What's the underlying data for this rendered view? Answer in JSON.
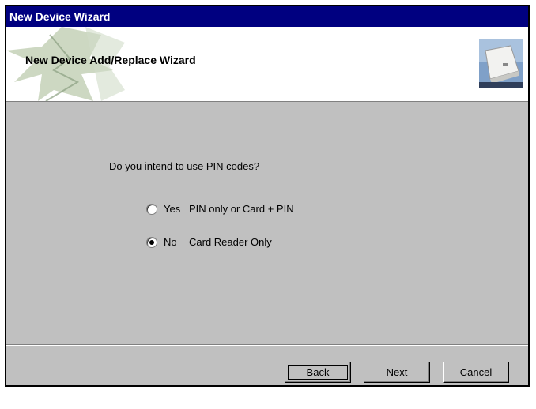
{
  "window": {
    "title": "New Device Wizard"
  },
  "header": {
    "title": "New Device Add/Replace Wizard"
  },
  "content": {
    "question": "Do you intend to use PIN codes?",
    "options": [
      {
        "value": "Yes",
        "description": "PIN only or Card + PIN",
        "selected": false
      },
      {
        "value": "No",
        "description": "Card Reader Only",
        "selected": true
      }
    ]
  },
  "buttons": {
    "back": {
      "mnemonic": "B",
      "rest": "ack"
    },
    "next": {
      "mnemonic": "N",
      "rest": "ext"
    },
    "cancel": {
      "mnemonic": "C",
      "rest": "ancel"
    }
  },
  "colors": {
    "titlebar": "#000080",
    "window": "#c0c0c0",
    "header": "#ffffff"
  },
  "icons": {
    "header_art": "leaf-illustration",
    "device": "card-reader-device-image"
  }
}
